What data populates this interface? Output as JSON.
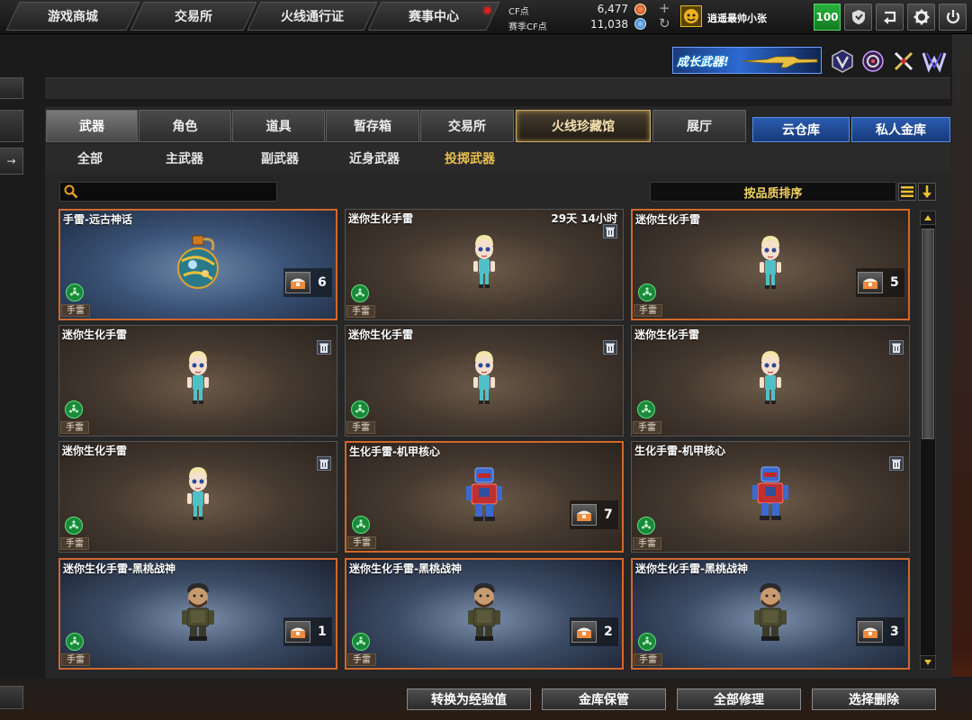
{
  "topnav": {
    "tabs": [
      "游戏商城",
      "交易所",
      "火线通行证",
      "赛事中心"
    ]
  },
  "currency": {
    "cf_label": "CF点",
    "cf_value": "6,477",
    "season_label": "赛季CF点",
    "season_value": "11,038"
  },
  "user": {
    "name": "逍遥最帅小张",
    "level": "100"
  },
  "icons": {
    "topbar_buttons": [
      "shield-icon",
      "return-icon",
      "gear-icon",
      "power-icon"
    ],
    "banner_icons": [
      "v-emblem-icon",
      "target-emblem-icon",
      "crossed-swords-icon",
      "w-emblem-icon"
    ]
  },
  "banner": {
    "text": "成长武器!"
  },
  "category_tabs": [
    "武器",
    "角色",
    "道具",
    "暂存箱",
    "交易所",
    "火线珍藏馆",
    "展厅"
  ],
  "vault_buttons": [
    "云仓库",
    "私人金库"
  ],
  "sub_tabs": [
    "全部",
    "主武器",
    "副武器",
    "近身武器",
    "投掷武器"
  ],
  "sort": {
    "label": "按品质排序"
  },
  "items": [
    {
      "name": "手雷-远古神话",
      "tag": "手雷",
      "count": "6",
      "timer": "",
      "variant": "ancient",
      "figure": "grenade"
    },
    {
      "name": "迷你生化手雷",
      "tag": "手雷",
      "count": "",
      "timer": "29天 14小时",
      "variant": "brown",
      "figure": "doll"
    },
    {
      "name": "迷你生化手雷",
      "tag": "手雷",
      "count": "5",
      "timer": "",
      "variant": "brown",
      "figure": "doll"
    },
    {
      "name": "迷你生化手雷",
      "tag": "手雷",
      "count": "",
      "timer": "",
      "variant": "brown",
      "figure": "doll"
    },
    {
      "name": "迷你生化手雷",
      "tag": "手雷",
      "count": "",
      "timer": "",
      "variant": "brown",
      "figure": "doll"
    },
    {
      "name": "迷你生化手雷",
      "tag": "手雷",
      "count": "",
      "timer": "",
      "variant": "brown",
      "figure": "doll"
    },
    {
      "name": "迷你生化手雷",
      "tag": "手雷",
      "count": "",
      "timer": "",
      "variant": "brown",
      "figure": "doll"
    },
    {
      "name": "生化手雷-机甲核心",
      "tag": "手雷",
      "count": "7",
      "timer": "",
      "variant": "brown",
      "figure": "robot"
    },
    {
      "name": "生化手雷-机甲核心",
      "tag": "手雷",
      "count": "",
      "timer": "",
      "variant": "brown",
      "figure": "robot"
    },
    {
      "name": "迷你生化手雷-黑桃战神",
      "tag": "手雷",
      "count": "1",
      "timer": "",
      "variant": "blue",
      "figure": "soldier"
    },
    {
      "name": "迷你生化手雷-黑桃战神",
      "tag": "手雷",
      "count": "2",
      "timer": "",
      "variant": "blue",
      "figure": "soldier"
    },
    {
      "name": "迷你生化手雷-黑桃战神",
      "tag": "手雷",
      "count": "3",
      "timer": "",
      "variant": "blue",
      "figure": "soldier"
    }
  ],
  "bottom_buttons": [
    "转换为经验值",
    "金库保管",
    "全部修理",
    "选择删除"
  ],
  "colors": {
    "selected_border": "#d2682c",
    "active_subtab": "#e8c04a",
    "vault_blue": "#2b5cb0",
    "level_green": "#27b33c"
  }
}
